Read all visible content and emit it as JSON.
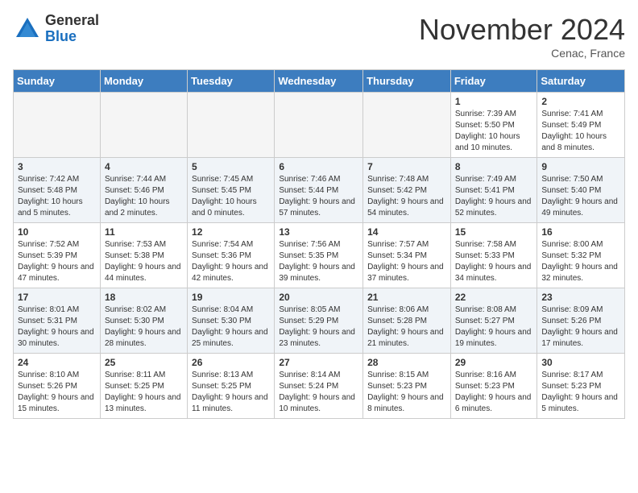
{
  "header": {
    "logo_general": "General",
    "logo_blue": "Blue",
    "month_title": "November 2024",
    "location": "Cenac, France"
  },
  "days_of_week": [
    "Sunday",
    "Monday",
    "Tuesday",
    "Wednesday",
    "Thursday",
    "Friday",
    "Saturday"
  ],
  "weeks": [
    [
      {
        "day": "",
        "info": ""
      },
      {
        "day": "",
        "info": ""
      },
      {
        "day": "",
        "info": ""
      },
      {
        "day": "",
        "info": ""
      },
      {
        "day": "",
        "info": ""
      },
      {
        "day": "1",
        "info": "Sunrise: 7:39 AM\nSunset: 5:50 PM\nDaylight: 10 hours and 10 minutes."
      },
      {
        "day": "2",
        "info": "Sunrise: 7:41 AM\nSunset: 5:49 PM\nDaylight: 10 hours and 8 minutes."
      }
    ],
    [
      {
        "day": "3",
        "info": "Sunrise: 7:42 AM\nSunset: 5:48 PM\nDaylight: 10 hours and 5 minutes."
      },
      {
        "day": "4",
        "info": "Sunrise: 7:44 AM\nSunset: 5:46 PM\nDaylight: 10 hours and 2 minutes."
      },
      {
        "day": "5",
        "info": "Sunrise: 7:45 AM\nSunset: 5:45 PM\nDaylight: 10 hours and 0 minutes."
      },
      {
        "day": "6",
        "info": "Sunrise: 7:46 AM\nSunset: 5:44 PM\nDaylight: 9 hours and 57 minutes."
      },
      {
        "day": "7",
        "info": "Sunrise: 7:48 AM\nSunset: 5:42 PM\nDaylight: 9 hours and 54 minutes."
      },
      {
        "day": "8",
        "info": "Sunrise: 7:49 AM\nSunset: 5:41 PM\nDaylight: 9 hours and 52 minutes."
      },
      {
        "day": "9",
        "info": "Sunrise: 7:50 AM\nSunset: 5:40 PM\nDaylight: 9 hours and 49 minutes."
      }
    ],
    [
      {
        "day": "10",
        "info": "Sunrise: 7:52 AM\nSunset: 5:39 PM\nDaylight: 9 hours and 47 minutes."
      },
      {
        "day": "11",
        "info": "Sunrise: 7:53 AM\nSunset: 5:38 PM\nDaylight: 9 hours and 44 minutes."
      },
      {
        "day": "12",
        "info": "Sunrise: 7:54 AM\nSunset: 5:36 PM\nDaylight: 9 hours and 42 minutes."
      },
      {
        "day": "13",
        "info": "Sunrise: 7:56 AM\nSunset: 5:35 PM\nDaylight: 9 hours and 39 minutes."
      },
      {
        "day": "14",
        "info": "Sunrise: 7:57 AM\nSunset: 5:34 PM\nDaylight: 9 hours and 37 minutes."
      },
      {
        "day": "15",
        "info": "Sunrise: 7:58 AM\nSunset: 5:33 PM\nDaylight: 9 hours and 34 minutes."
      },
      {
        "day": "16",
        "info": "Sunrise: 8:00 AM\nSunset: 5:32 PM\nDaylight: 9 hours and 32 minutes."
      }
    ],
    [
      {
        "day": "17",
        "info": "Sunrise: 8:01 AM\nSunset: 5:31 PM\nDaylight: 9 hours and 30 minutes."
      },
      {
        "day": "18",
        "info": "Sunrise: 8:02 AM\nSunset: 5:30 PM\nDaylight: 9 hours and 28 minutes."
      },
      {
        "day": "19",
        "info": "Sunrise: 8:04 AM\nSunset: 5:30 PM\nDaylight: 9 hours and 25 minutes."
      },
      {
        "day": "20",
        "info": "Sunrise: 8:05 AM\nSunset: 5:29 PM\nDaylight: 9 hours and 23 minutes."
      },
      {
        "day": "21",
        "info": "Sunrise: 8:06 AM\nSunset: 5:28 PM\nDaylight: 9 hours and 21 minutes."
      },
      {
        "day": "22",
        "info": "Sunrise: 8:08 AM\nSunset: 5:27 PM\nDaylight: 9 hours and 19 minutes."
      },
      {
        "day": "23",
        "info": "Sunrise: 8:09 AM\nSunset: 5:26 PM\nDaylight: 9 hours and 17 minutes."
      }
    ],
    [
      {
        "day": "24",
        "info": "Sunrise: 8:10 AM\nSunset: 5:26 PM\nDaylight: 9 hours and 15 minutes."
      },
      {
        "day": "25",
        "info": "Sunrise: 8:11 AM\nSunset: 5:25 PM\nDaylight: 9 hours and 13 minutes."
      },
      {
        "day": "26",
        "info": "Sunrise: 8:13 AM\nSunset: 5:25 PM\nDaylight: 9 hours and 11 minutes."
      },
      {
        "day": "27",
        "info": "Sunrise: 8:14 AM\nSunset: 5:24 PM\nDaylight: 9 hours and 10 minutes."
      },
      {
        "day": "28",
        "info": "Sunrise: 8:15 AM\nSunset: 5:23 PM\nDaylight: 9 hours and 8 minutes."
      },
      {
        "day": "29",
        "info": "Sunrise: 8:16 AM\nSunset: 5:23 PM\nDaylight: 9 hours and 6 minutes."
      },
      {
        "day": "30",
        "info": "Sunrise: 8:17 AM\nSunset: 5:23 PM\nDaylight: 9 hours and 5 minutes."
      }
    ]
  ]
}
